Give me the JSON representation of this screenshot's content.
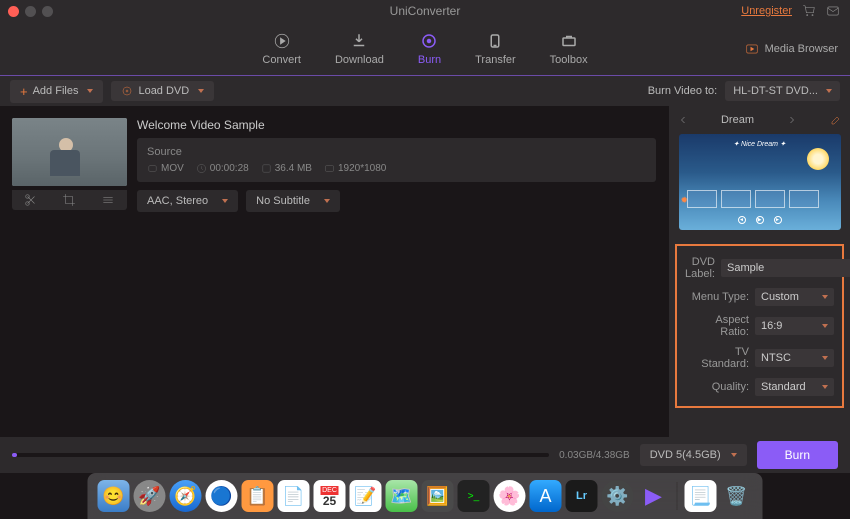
{
  "titlebar": {
    "title": "UniConverter",
    "unregister": "Unregister"
  },
  "tabs": {
    "convert": "Convert",
    "download": "Download",
    "burn": "Burn",
    "transfer": "Transfer",
    "toolbox": "Toolbox",
    "media_browser": "Media Browser"
  },
  "toolbar": {
    "add_files": "Add Files",
    "load_dvd": "Load DVD",
    "burn_to_label": "Burn Video to:",
    "drive": "HL-DT-ST DVD..."
  },
  "video": {
    "title": "Welcome Video Sample",
    "source_label": "Source",
    "format": "MOV",
    "duration": "00:00:28",
    "size": "36.4 MB",
    "resolution": "1920*1080",
    "audio_dd": "AAC, Stereo",
    "subtitle_dd": "No Subtitle"
  },
  "theme": {
    "name": "Dream",
    "preview_title": "Nice Dream"
  },
  "settings": {
    "dvd_label_k": "DVD Label:",
    "dvd_label_v": "Sample",
    "menu_type_k": "Menu Type:",
    "menu_type_v": "Custom",
    "aspect_k": "Aspect Ratio:",
    "aspect_v": "16:9",
    "tv_k": "TV Standard:",
    "tv_v": "NTSC",
    "quality_k": "Quality:",
    "quality_v": "Standard"
  },
  "bottom": {
    "progress_text": "0.03GB/4.38GB",
    "disc": "DVD 5(4.5GB)",
    "burn_btn": "Burn"
  }
}
